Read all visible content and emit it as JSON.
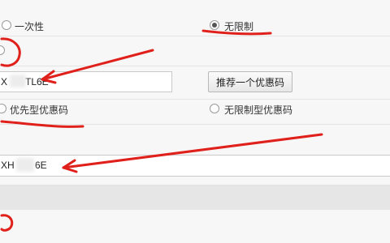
{
  "options_row1": {
    "left_label": "一次性",
    "right_label": "无限制",
    "right_selected": true
  },
  "coupon1": {
    "value_prefix": "X",
    "value_suffix": "TL6E",
    "recommend_button": "推荐一个优惠码"
  },
  "options_row2": {
    "left_label": "优先型优惠码",
    "right_label": "无限制型优惠码"
  },
  "coupon2": {
    "value_prefix": "XH",
    "value_suffix": "6E"
  },
  "colors": {
    "annotation": "#e0201b",
    "background": "#f5f5f5",
    "input_border": "#c9c9c9"
  },
  "annotations": "red hand-drawn underlines, circles and arrows"
}
